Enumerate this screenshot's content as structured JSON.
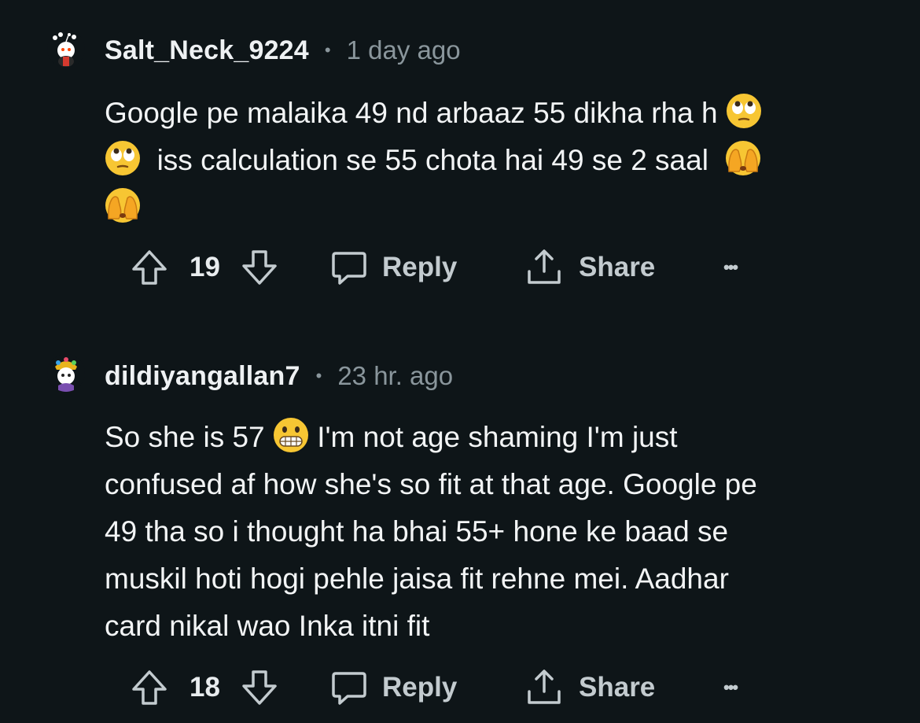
{
  "comments": [
    {
      "username": "Salt_Neck_9224",
      "separator": "•",
      "time": "1 day ago",
      "text_1": "Google pe malaika 49 nd arbaaz 55 dikha rha h",
      "text_2": "iss calculation se 55 chota hai 49 se 2 saal",
      "emojis": [
        "eye-roll-emoji",
        "eye-roll-emoji",
        "hands-over-face-emoji",
        "hands-over-face-emoji"
      ],
      "score": "19",
      "reply_label": "Reply",
      "share_label": "Share",
      "more_label": "•••"
    },
    {
      "username": "dildiyangallan7",
      "separator": "•",
      "time": "23 hr. ago",
      "line_1_pre": "So she is 57",
      "line_1_post": "I'm not age shaming I'm just",
      "line_2": "confused af how she's so fit at that age. Google pe",
      "line_3": "49 tha so i thought ha bhai 55+ hone ke baad se",
      "line_4": "muskil hoti hogi pehle jaisa fit rehne mei. Aadhar",
      "line_5": "card nikal wao Inka itni fit",
      "emojis": [
        "grimacing-emoji"
      ],
      "score": "18",
      "reply_label": "Reply",
      "share_label": "Share",
      "more_label": "•••"
    }
  ],
  "colors": {
    "background": "#0e1518",
    "text": "#f2f4f5",
    "muted": "#8a969c",
    "action": "#c3cbcf"
  }
}
